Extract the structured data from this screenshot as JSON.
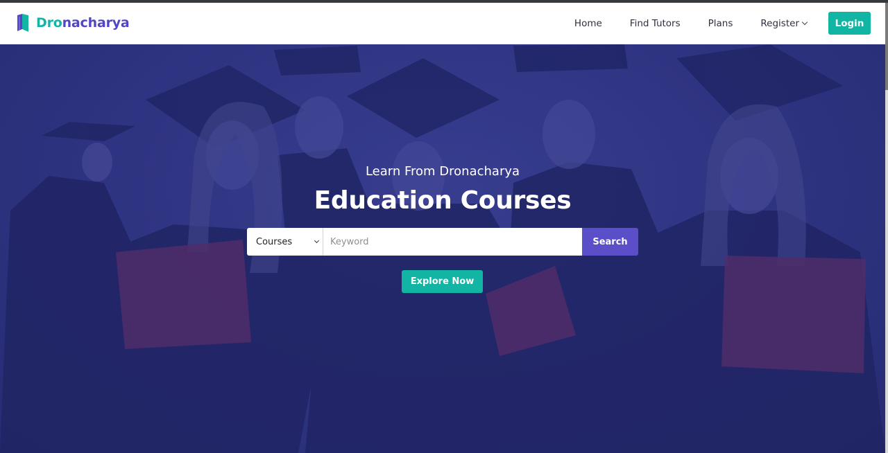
{
  "brand": {
    "name_part1": "Dro",
    "name_part2": "nacharya",
    "logo_icon": "book-logo-icon"
  },
  "nav": {
    "home": "Home",
    "find_tutors": "Find Tutors",
    "plans": "Plans",
    "register": "Register",
    "login": "Login"
  },
  "hero": {
    "kicker": "Learn From Dronacharya",
    "title": "Education Courses",
    "background": "graduates-photo",
    "search": {
      "category_selected": "Courses",
      "keyword_placeholder": "Keyword",
      "keyword_value": "",
      "button_label": "Search"
    },
    "explore_label": "Explore Now"
  },
  "colors": {
    "accent_teal": "#12b4a3",
    "accent_purple": "#5a4ec9",
    "hero_overlay": "#2d3382"
  }
}
